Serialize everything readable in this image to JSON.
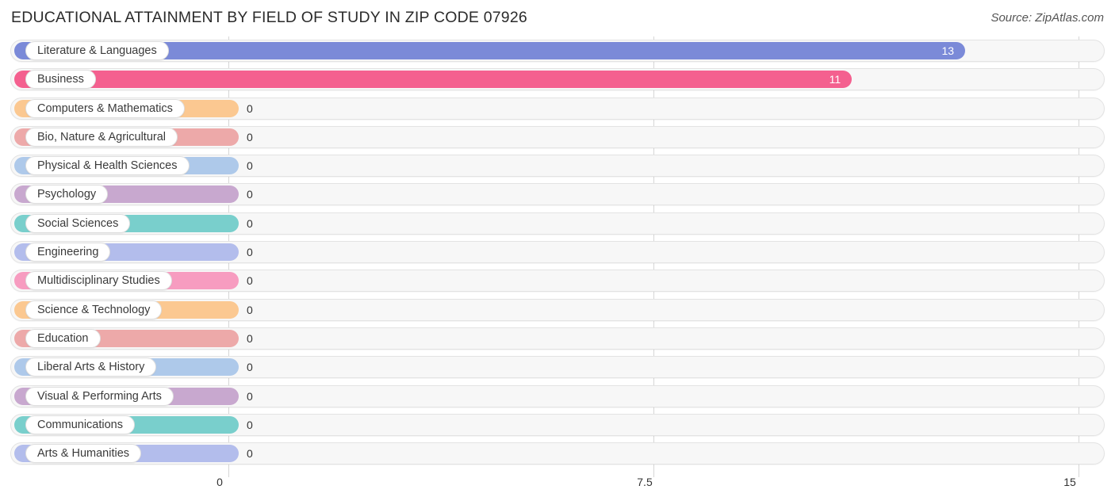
{
  "header": {
    "title": "EDUCATIONAL ATTAINMENT BY FIELD OF STUDY IN ZIP CODE 07926",
    "source": "Source: ZipAtlas.com"
  },
  "chart_data": {
    "type": "bar",
    "orientation": "horizontal",
    "title": "EDUCATIONAL ATTAINMENT BY FIELD OF STUDY IN ZIP CODE 07926",
    "subtitle": "",
    "xlabel": "",
    "ylabel": "",
    "xlim": [
      0,
      15
    ],
    "xticks": [
      0,
      7.5,
      15
    ],
    "xtick_labels": [
      "0",
      "7.5",
      "15"
    ],
    "grid": true,
    "legend": false,
    "categories": [
      "Literature & Languages",
      "Business",
      "Computers & Mathematics",
      "Bio, Nature & Agricultural",
      "Physical & Health Sciences",
      "Psychology",
      "Social Sciences",
      "Engineering",
      "Multidisciplinary Studies",
      "Science & Technology",
      "Education",
      "Liberal Arts & History",
      "Visual & Performing Arts",
      "Communications",
      "Arts & Humanities"
    ],
    "values": [
      13,
      11,
      0,
      0,
      0,
      0,
      0,
      0,
      0,
      0,
      0,
      0,
      0,
      0,
      0
    ],
    "value_labels": [
      "13",
      "11",
      "0",
      "0",
      "0",
      "0",
      "0",
      "0",
      "0",
      "0",
      "0",
      "0",
      "0",
      "0",
      "0"
    ],
    "colors": [
      "#7b8ad8",
      "#f4608f",
      "#fbc891",
      "#eda9a9",
      "#aec9ea",
      "#c8a8cf",
      "#79cfcc",
      "#b3bdec",
      "#f79cc0",
      "#fbc891",
      "#eda9a9",
      "#aec9ea",
      "#c8a8cf",
      "#79cfcc",
      "#b3bdec"
    ]
  },
  "colors": {
    "track_fill": "#f7f7f7",
    "track_border": "#e3e3e3",
    "gridline": "#d6d6d6",
    "title_text": "#2b2b2b",
    "label_text": "#3a3a3a",
    "value_inside_text": "#ffffff",
    "value_outside_text": "#333333",
    "background": "#ffffff"
  }
}
